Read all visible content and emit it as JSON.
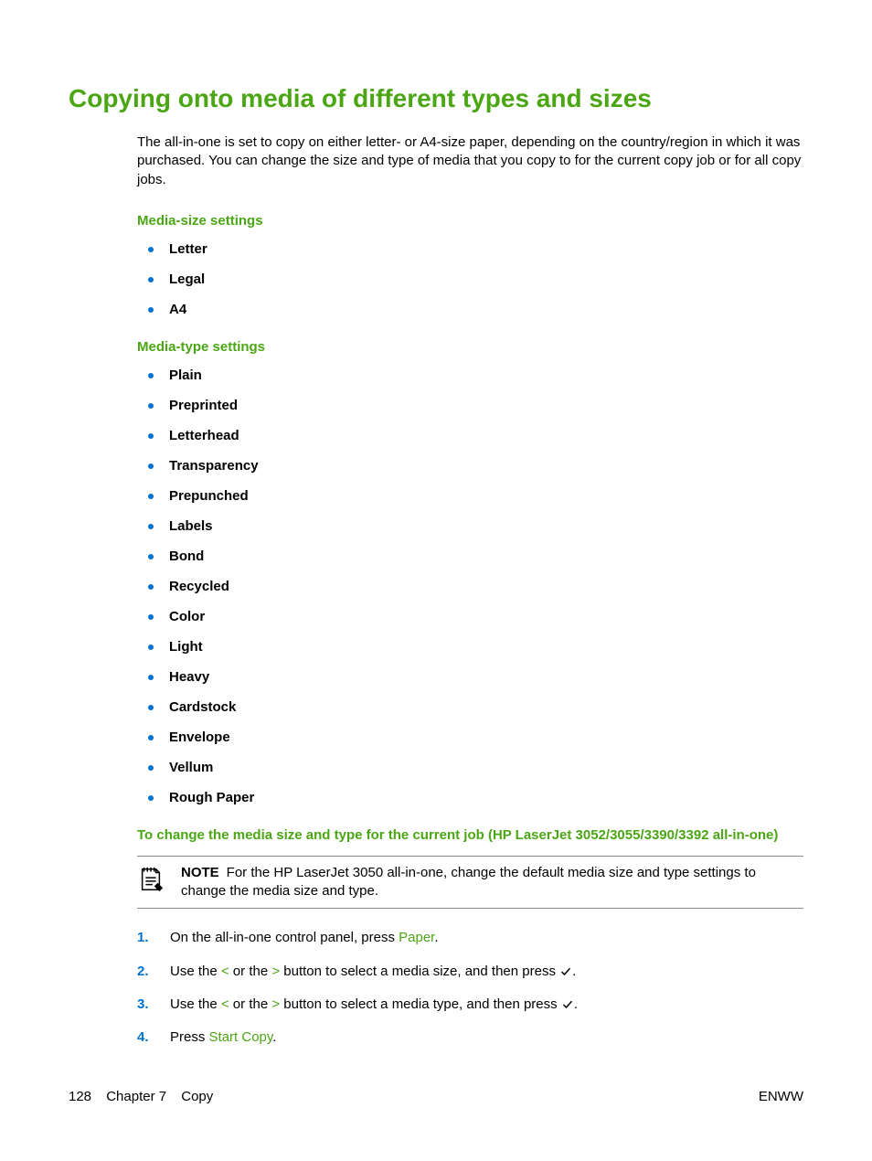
{
  "title": "Copying onto media of different types and sizes",
  "intro": "The all-in-one is set to copy on either letter- or A4-size paper, depending on the country/region in which it was purchased. You can change the size and type of media that you copy to for the current copy job or for all copy jobs.",
  "mediaSizeHeading": "Media-size settings",
  "mediaSizes": [
    "Letter",
    "Legal",
    "A4"
  ],
  "mediaTypeHeading": "Media-type settings",
  "mediaTypes": [
    "Plain",
    "Preprinted",
    "Letterhead",
    "Transparency",
    "Prepunched",
    "Labels",
    "Bond",
    "Recycled",
    "Color",
    "Light",
    "Heavy",
    "Cardstock",
    "Envelope",
    "Vellum",
    "Rough Paper"
  ],
  "changeHeading": "To change the media size and type for the current job (HP LaserJet 3052/3055/3390/3392 all-in-one)",
  "note": {
    "label": "NOTE",
    "text": "For the HP LaserJet 3050 all-in-one, change the default media size and type settings to change the media size and type."
  },
  "steps": {
    "s1": {
      "a": "On the all-in-one control panel, press ",
      "paper": "Paper",
      "b": "."
    },
    "s2": {
      "a": "Use the ",
      "lt": "<",
      "b": " or the ",
      "gt": ">",
      "c": " button to select a media size, and then press "
    },
    "s3": {
      "a": "Use the ",
      "lt": "<",
      "b": " or the ",
      "gt": ">",
      "c": " button to select a media type, and then press "
    },
    "s4": {
      "a": "Press ",
      "start": "Start Copy",
      "b": "."
    }
  },
  "footer": {
    "page": "128",
    "chapter": "Chapter 7",
    "section": "Copy",
    "lang": "ENWW"
  }
}
